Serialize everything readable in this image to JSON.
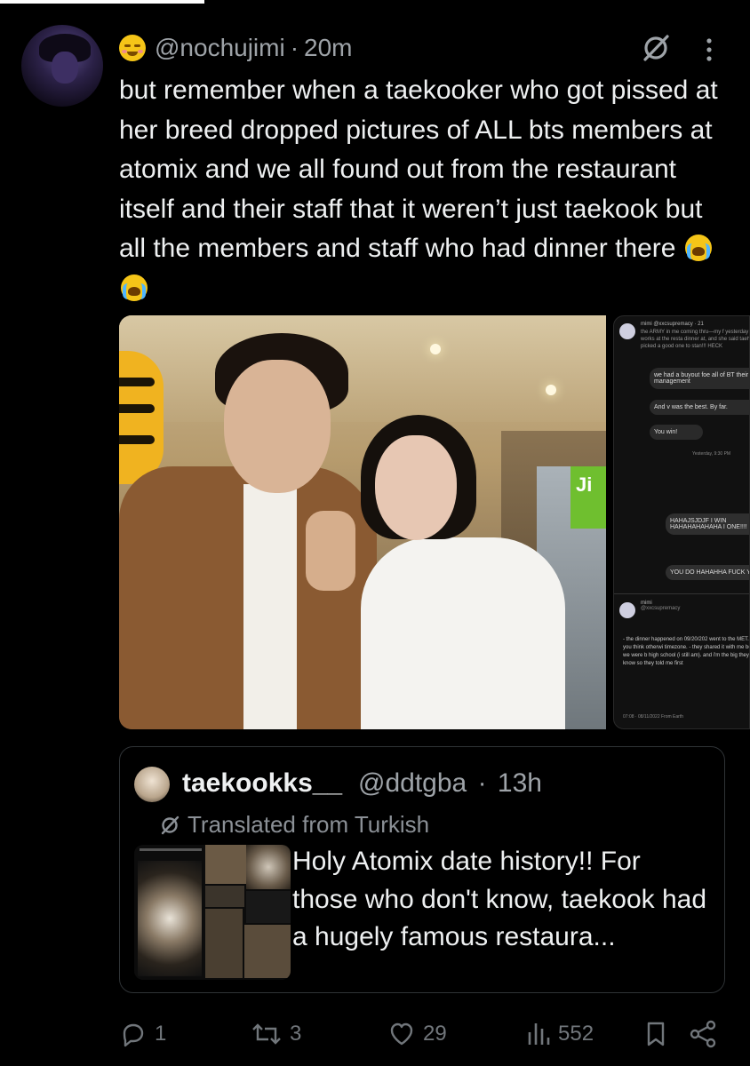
{
  "tweet": {
    "display_emoji": "emoji-relieved-face",
    "handle": "@nochujimi",
    "separator": "·",
    "time": "20m",
    "text": "but remember when a taekooker who got pissed at her breed dropped pictures of ALL bts members at atomix and we all found out from the restaurant itself and their staff that it weren’t just taekook but all the members and staff who had dinner there"
  },
  "media": {
    "sign_text": "Ji",
    "chat": {
      "header_name": "mimi",
      "header_handle": "@xxcsupremacy · 21",
      "message_1": "the ARMY in me coming thru—my f yesterday bc she works at the resta dinner at, and she said taehyung w picked a good one to stan!!! HECK",
      "bubble_1": "we had a buyout foe all of BT their management",
      "bubble_2": "And v was the best. By far.",
      "bubble_3": "You win!",
      "timestamp": "Yesterday, 9:30 PM",
      "my_bubble_1": "HAHAJSJDJF I WIN HAHAHAHAHAHA I ONE!!!!",
      "my_bubble_2": "YOU DO HAHAHHA FUCK Y",
      "reply_name": "mimi",
      "reply_handle": "@xxcsupremacy",
      "reply_text": "- the dinner happened on 09/20/202 went to the MET. if you think otherwi timezone. - they shared it with me bc we were b high school (i still am). and i'm the big they know so they told me first",
      "reply_time": "07:08 · 08/11/2022 From Earth"
    }
  },
  "quote": {
    "name": "taekookks__",
    "handle": "@ddtgba",
    "separator": "·",
    "time": "13h",
    "translated": "Translated from Turkish",
    "text": "Holy Atomix date history!! For those who don't know, taekook had a hugely famous restaura..."
  },
  "actions": {
    "replies": "1",
    "reposts": "3",
    "likes": "29",
    "views": "552"
  },
  "colors": {
    "background": "#000000",
    "text": "#e7e9ea",
    "muted": "#71767b",
    "border": "#2f3336"
  }
}
